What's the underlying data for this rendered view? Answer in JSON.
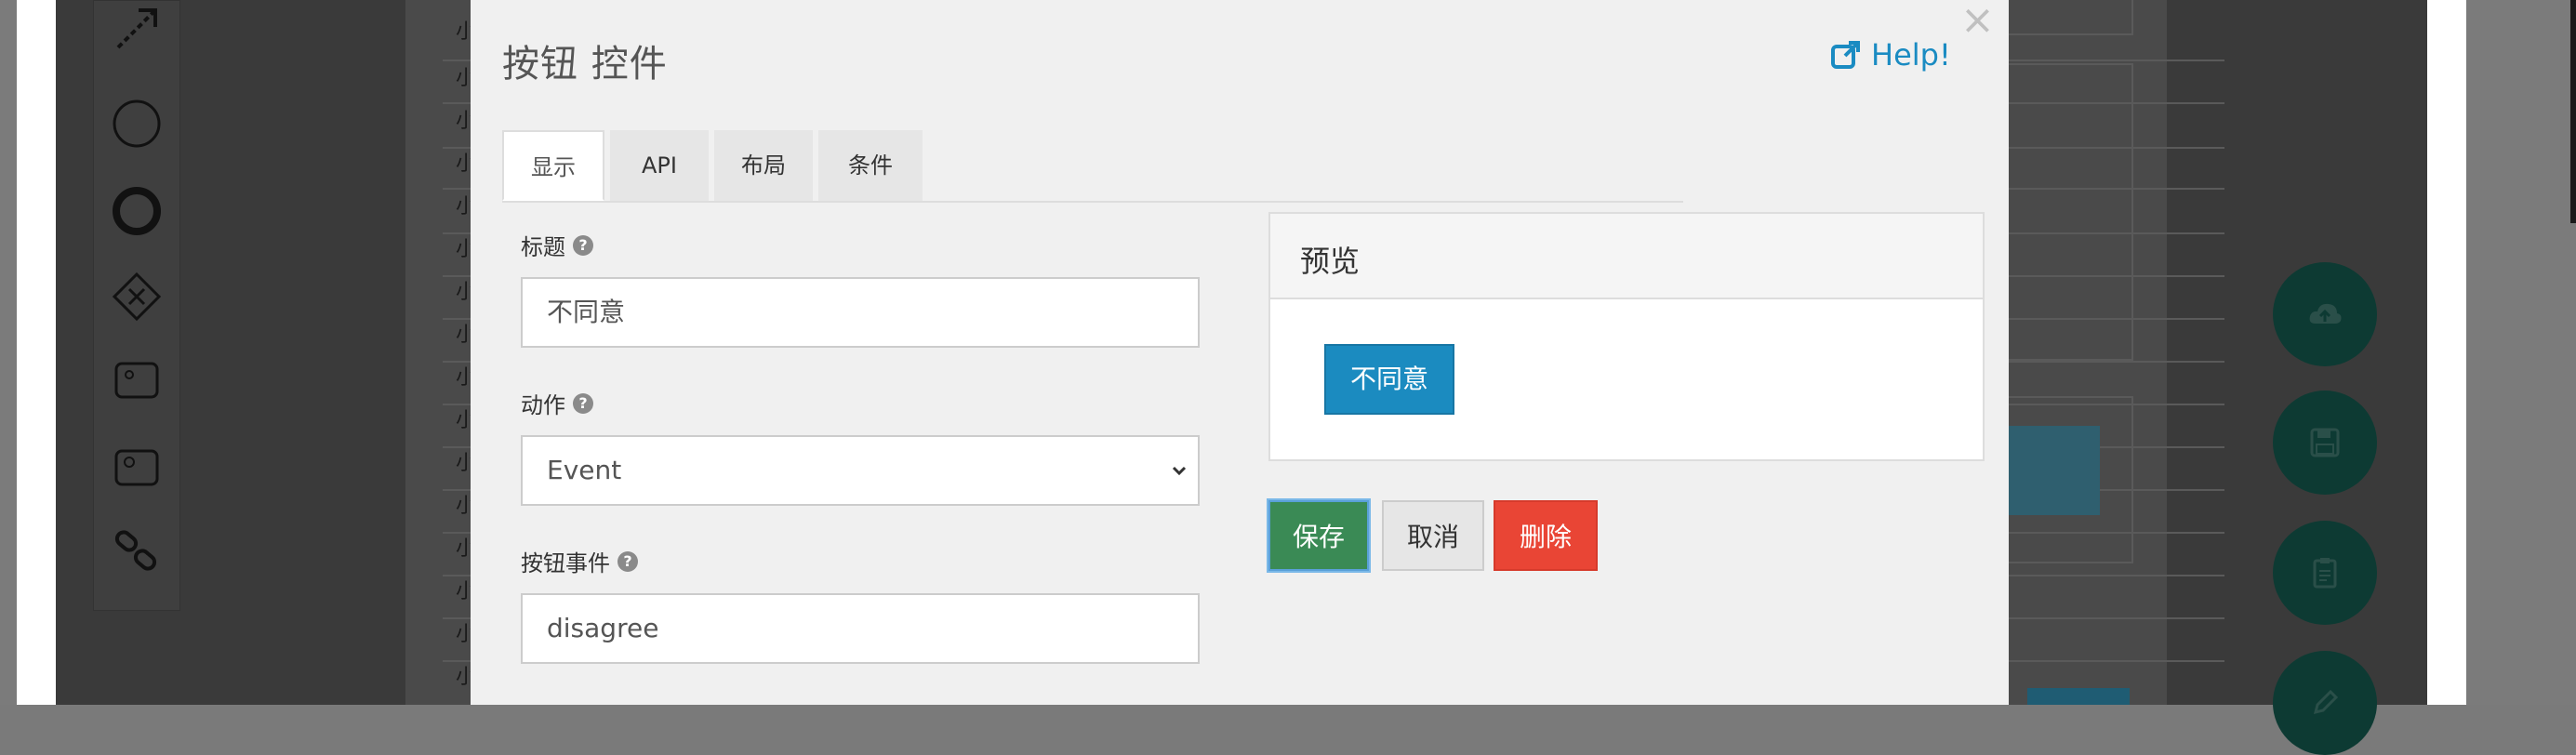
{
  "modal": {
    "title": "按钮 控件",
    "close_glyph": "×",
    "help_label": "Help!",
    "tabs": [
      {
        "label": "显示",
        "active": true
      },
      {
        "label": "API",
        "active": false
      },
      {
        "label": "布局",
        "active": false
      },
      {
        "label": "条件",
        "active": false
      }
    ],
    "fields": {
      "title_label": "标题",
      "title_value": "不同意",
      "action_label": "动作",
      "action_value": "Event",
      "event_label": "按钮事件",
      "event_value": "disagree",
      "help_glyph": "?"
    },
    "preview": {
      "heading": "预览",
      "button_label": "不同意"
    },
    "buttons": {
      "save": "保存",
      "cancel": "取消",
      "delete": "删除"
    }
  },
  "background": {
    "row_char": "小",
    "fab_icons": [
      "cloud-upload-icon",
      "save-icon",
      "clipboard-icon",
      "edit-icon"
    ]
  },
  "colors": {
    "primary": "#1b8bc0",
    "success": "#3a8a55",
    "danger": "#e94535",
    "fab": "#0d3a33"
  }
}
